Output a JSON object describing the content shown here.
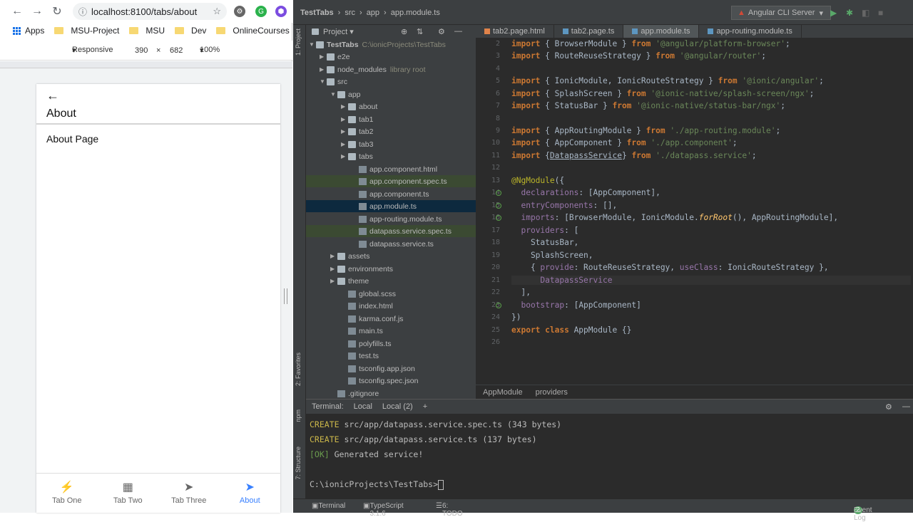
{
  "browser": {
    "url": "localhost:8100/tabs/about",
    "bookmarks": [
      "Apps",
      "MSU-Project",
      "MSU",
      "Dev",
      "OnlineCourses"
    ],
    "devtools": {
      "mode": "Responsive",
      "width": "390",
      "x": "×",
      "height": "682",
      "zoom": "100%"
    }
  },
  "app": {
    "back_icon": "arrow-back-icon",
    "title": "About",
    "content": "About Page",
    "tabs": [
      {
        "label": "Tab One",
        "icon": "flash-icon"
      },
      {
        "label": "Tab Two",
        "icon": "apps-icon"
      },
      {
        "label": "Tab Three",
        "icon": "send-icon"
      },
      {
        "label": "About",
        "icon": "send-icon",
        "selected": true
      }
    ],
    "accent": "#3880ff"
  },
  "ide": {
    "breadcrumbs": [
      "TestTabs",
      "src",
      "app",
      "app.module.ts"
    ],
    "run_config": "Angular CLI Server",
    "project_label": "Project",
    "tool_windows": [
      "1: Project",
      "2: Favorites",
      "npm",
      "7: Structure"
    ],
    "tree": [
      {
        "label": "TestTabs",
        "note": "C:\\ionicProjects\\TestTabs"
      },
      {
        "label": "e2e"
      },
      {
        "label": "node_modules",
        "note": "library root"
      },
      {
        "label": "src"
      },
      {
        "label": "app"
      },
      {
        "label": "about"
      },
      {
        "label": "tab1"
      },
      {
        "label": "tab2"
      },
      {
        "label": "tab3"
      },
      {
        "label": "tabs"
      },
      {
        "label": "app.component.html"
      },
      {
        "label": "app.component.spec.ts"
      },
      {
        "label": "app.component.ts"
      },
      {
        "label": "app.module.ts"
      },
      {
        "label": "app-routing.module.ts"
      },
      {
        "label": "datapass.service.spec.ts"
      },
      {
        "label": "datapass.service.ts"
      },
      {
        "label": "assets"
      },
      {
        "label": "environments"
      },
      {
        "label": "theme"
      },
      {
        "label": "global.scss"
      },
      {
        "label": "index.html"
      },
      {
        "label": "karma.conf.js"
      },
      {
        "label": "main.ts"
      },
      {
        "label": "polyfills.ts"
      },
      {
        "label": "test.ts"
      },
      {
        "label": "tsconfig.app.json"
      },
      {
        "label": "tsconfig.spec.json"
      },
      {
        "label": ".gitignore"
      }
    ],
    "editor_tabs": [
      "tab2.page.html",
      "tab2.page.ts",
      "app.module.ts",
      "app-routing.module.ts"
    ],
    "line_numbers": [
      "2",
      "3",
      "4",
      "5",
      "6",
      "7",
      "8",
      "9",
      "10",
      "11",
      "12",
      "13",
      "14",
      "15",
      "16",
      "17",
      "18",
      "19",
      "20",
      "21",
      "22",
      "23",
      "24",
      "25",
      "26"
    ],
    "code_breadcrumb": [
      "AppModule",
      "providers"
    ],
    "terminal": {
      "label": "Terminal:",
      "tabs": [
        "Local",
        "Local (2)"
      ],
      "add": "+",
      "lines": [
        {
          "prefix": "CREATE",
          "text": " src/app/datapass.service.spec.ts (343 bytes)"
        },
        {
          "prefix": "CREATE",
          "text": " src/app/datapass.service.ts (137 bytes)"
        },
        {
          "prefix": "[OK]",
          "text": " Generated service!"
        }
      ],
      "prompt": "C:\\ionicProjects\\TestTabs>"
    },
    "status": {
      "terminal": "Terminal",
      "typescript": "TypeScript 3.1.6",
      "todo": "6: TODO",
      "event_log": "Event Log",
      "event_count": "2"
    }
  }
}
